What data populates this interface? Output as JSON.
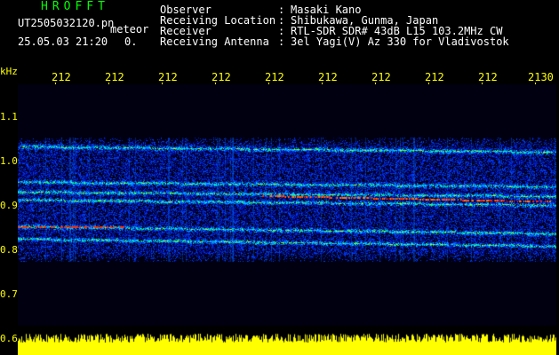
{
  "header": {
    "program": "HROFFT",
    "filename": "UT2505032120.pn",
    "mode": "meteor",
    "datetime": "25.05.03 21:20",
    "count": "0.",
    "fields": [
      {
        "label": "Observer",
        "value": "Masaki Kano"
      },
      {
        "label": "Receiving Location",
        "value": "Shibukawa, Gunma, Japan"
      },
      {
        "label": "Receiver",
        "value": "RTL-SDR SDR# 43dB L15 103.2MHz CW"
      },
      {
        "label": "Receiving Antenna",
        "value": "3el Yagi(V) Az 330 for Vladivostok"
      }
    ]
  },
  "time_axis": {
    "labels": [
      "212",
      "212",
      "212",
      "212",
      "212",
      "212",
      "212",
      "212",
      "212",
      "2130"
    ]
  },
  "freq_axis": {
    "unit": "kHz",
    "labels": [
      "1.1",
      "1.0",
      "0.9",
      "0.8",
      "0.7",
      "0.6"
    ]
  },
  "colors": {
    "text": "#ffffff",
    "axis": "#ffff00",
    "title": "#00ff00",
    "signal": "#ffff00"
  }
}
